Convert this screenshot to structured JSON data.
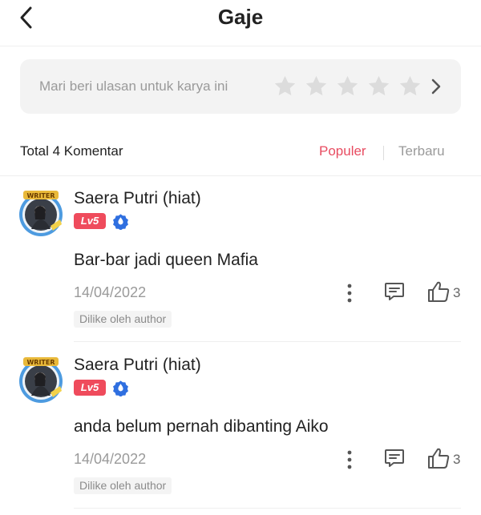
{
  "header": {
    "title": "Gaje"
  },
  "review": {
    "prompt": "Mari beri ulasan untuk karya ini",
    "stars": 5,
    "rated": 0
  },
  "comments_bar": {
    "count_label": "Total 4 Komentar",
    "tabs": [
      "Populer",
      "Terbaru"
    ],
    "active_tab": "Populer"
  },
  "comments": [
    {
      "author": "Saera Putri (hiat)",
      "level": "Lv5",
      "text": "Bar-bar jadi queen Mafia",
      "date": "14/04/2022",
      "likes": "3",
      "liked_by_author": "Dilike oleh author"
    },
    {
      "author": "Saera Putri (hiat)",
      "level": "Lv5",
      "text": "anda belum pernah dibanting Aiko",
      "date": "14/04/2022",
      "likes": "3",
      "liked_by_author": "Dilike oleh author"
    }
  ],
  "colors": {
    "accent": "#e84c61",
    "level_badge": "#ef4b5c",
    "verified_badge": "#2f6fe0"
  }
}
